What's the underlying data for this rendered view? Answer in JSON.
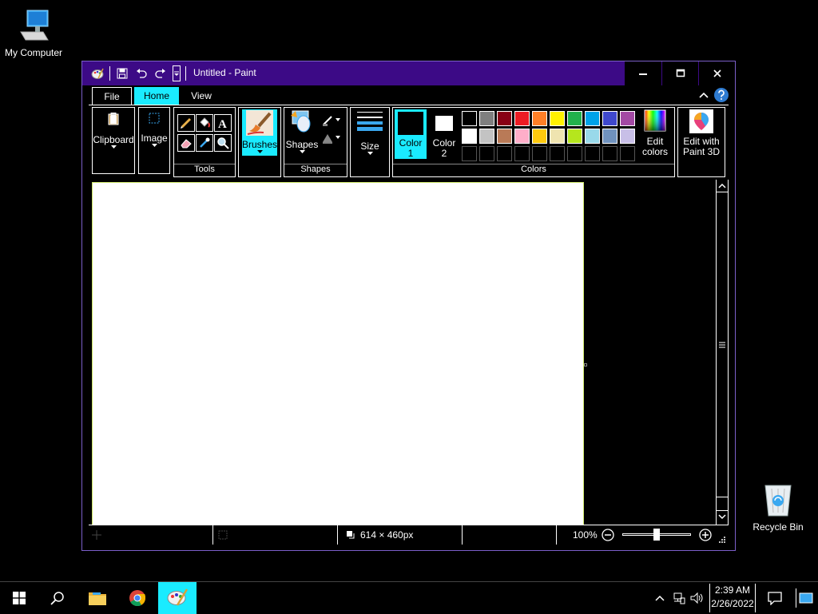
{
  "desktop": {
    "icons": [
      {
        "label": "My Computer"
      },
      {
        "label": "Recycle Bin"
      }
    ]
  },
  "window": {
    "title": "Untitled - Paint",
    "tabs": [
      {
        "label": "File"
      },
      {
        "label": "Home"
      },
      {
        "label": "View"
      }
    ],
    "ribbon": {
      "clipboard_label": "Clipboard",
      "image_label": "Image",
      "tools_label": "Tools",
      "brushes_label": "Brushes",
      "shapes_btn_label": "Shapes",
      "shapes_group_label": "Shapes",
      "size_label": "Size",
      "color1_label": "Color",
      "color1_num": "1",
      "color2_label": "Color",
      "color2_num": "2",
      "colors_group_label": "Colors",
      "edit_colors_line1": "Edit",
      "edit_colors_line2": "colors",
      "paint3d_line1": "Edit with",
      "paint3d_line2": "Paint 3D"
    },
    "palette_row1": [
      "#000000",
      "#7f7f7f",
      "#880015",
      "#ed1c24",
      "#ff7f27",
      "#fff200",
      "#22b14c",
      "#00a2e8",
      "#3f48cc",
      "#a349a4"
    ],
    "palette_row2": [
      "#ffffff",
      "#c3c3c3",
      "#b97a57",
      "#ffaec9",
      "#ffc90e",
      "#efe4b0",
      "#b5e61d",
      "#99d9ea",
      "#7092be",
      "#c8bfe7"
    ],
    "color1": "#000000",
    "color2": "#ffffff",
    "accent": "#1aebff",
    "title_bg": "#3c0a86",
    "status": {
      "canvas_size": "614 × 460px",
      "zoom": "100%"
    }
  },
  "taskbar": {
    "time": "2:39 AM",
    "date": "2/26/2022"
  }
}
